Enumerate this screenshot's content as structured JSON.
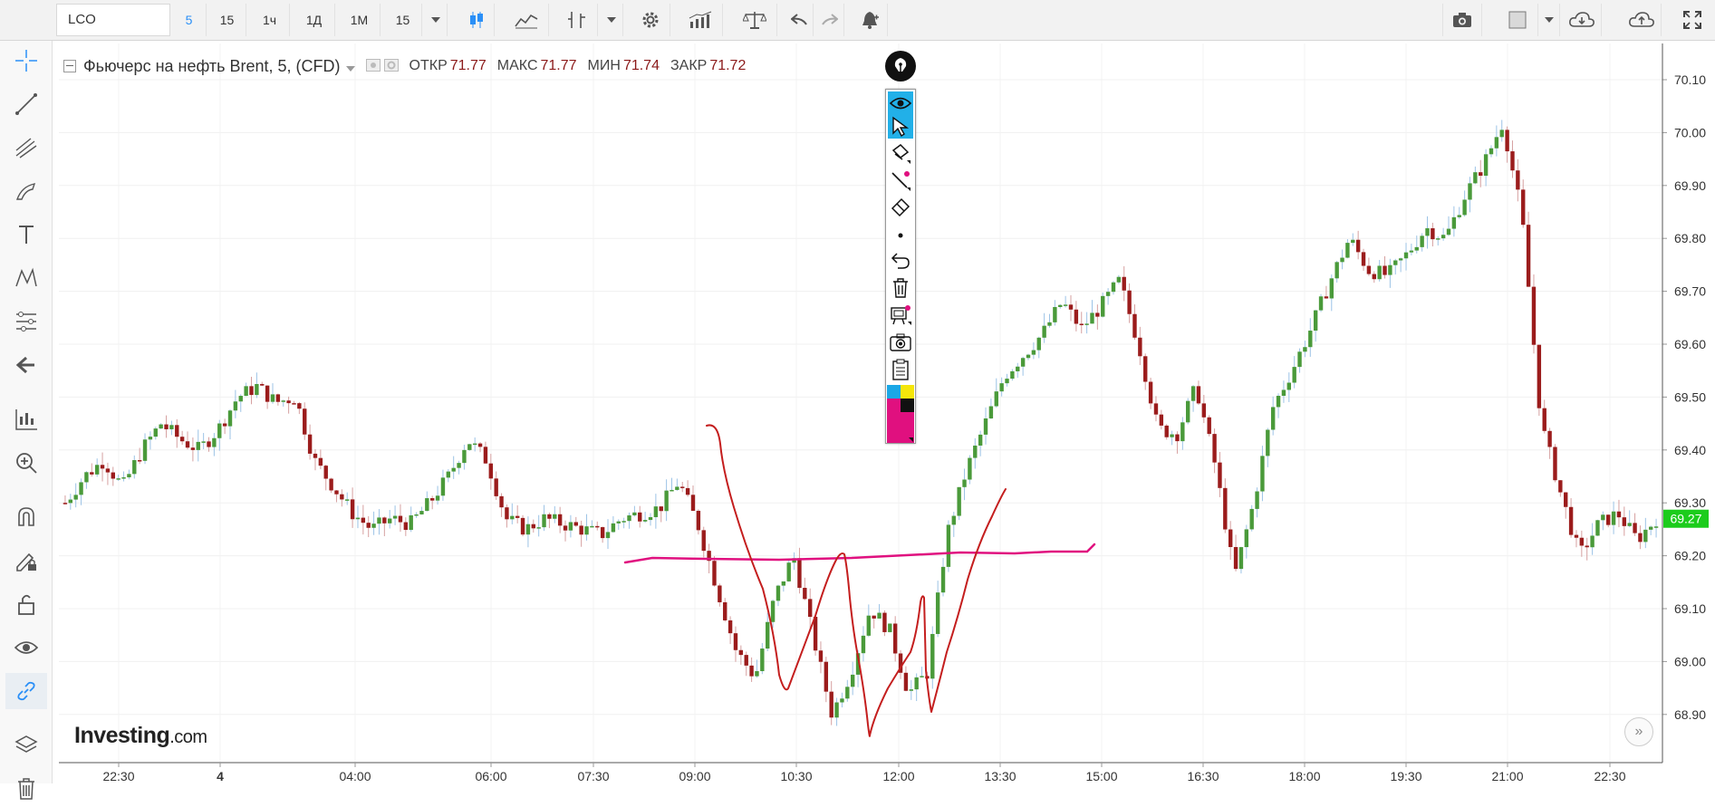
{
  "toolbar": {
    "symbol": "LCO",
    "intervals": [
      "5",
      "15",
      "1ч",
      "1Д",
      "1М",
      "15"
    ],
    "active_interval": "5"
  },
  "legend": {
    "title": "Фьючерс на нефть Brent, 5, (CFD)",
    "open_label": "ОТКР",
    "open": "71.77",
    "high_label": "МАКС",
    "high": "71.77",
    "low_label": "МИН",
    "low": "71.74",
    "close_label": "ЗАКР",
    "close": "71.72"
  },
  "watermark": {
    "brand": "Investing",
    "suffix": ".com"
  },
  "colors": {
    "up": "#4a9a3a",
    "down": "#9b1c1c",
    "price_tag": "#1ccc1c",
    "pen_red": "#c41e1e",
    "pen_magenta": "#e0107f",
    "accent": "#2a8ff7"
  },
  "chart_data": {
    "type": "candlestick",
    "title": "Фьючерс на нефть Brent, 5, (CFD)",
    "ylim": [
      68.83,
      70.15
    ],
    "y_ticks": [
      "70.10",
      "70.00",
      "69.90",
      "69.80",
      "69.70",
      "69.60",
      "69.50",
      "69.40",
      "69.30",
      "69.20",
      "69.10",
      "69.00",
      "68.90"
    ],
    "x_ticks": [
      "22:30",
      "4",
      "04:00",
      "06:00",
      "07:30",
      "09:00",
      "10:30",
      "12:00",
      "13:30",
      "15:00",
      "16:30",
      "18:00",
      "19:30",
      "21:00",
      "22:30"
    ],
    "last_price": "69.27",
    "close_path": [
      69.3,
      69.35,
      69.38,
      69.33,
      69.4,
      69.45,
      69.42,
      69.4,
      69.44,
      69.5,
      69.52,
      69.49,
      69.5,
      69.38,
      69.33,
      69.28,
      69.25,
      69.27,
      69.26,
      69.3,
      69.35,
      69.42,
      69.38,
      69.27,
      69.25,
      69.27,
      69.26,
      69.25,
      69.24,
      69.27,
      69.28,
      69.29,
      69.34,
      69.26,
      69.14,
      69.02,
      68.97,
      69.12,
      69.2,
      69.05,
      68.9,
      68.98,
      69.1,
      69.06,
      68.94,
      68.98,
      69.24,
      69.36,
      69.45,
      69.54,
      69.58,
      69.62,
      69.68,
      69.63,
      69.67,
      69.72,
      69.6,
      69.44,
      69.43,
      69.52,
      69.37,
      69.16,
      69.3,
      69.48,
      69.55,
      69.63,
      69.72,
      69.8,
      69.74,
      69.73,
      69.77,
      69.82,
      69.8,
      69.88,
      69.94,
      70.02,
      69.84,
      69.45,
      69.32,
      69.2,
      69.26,
      69.28,
      69.23,
      69.27
    ]
  }
}
